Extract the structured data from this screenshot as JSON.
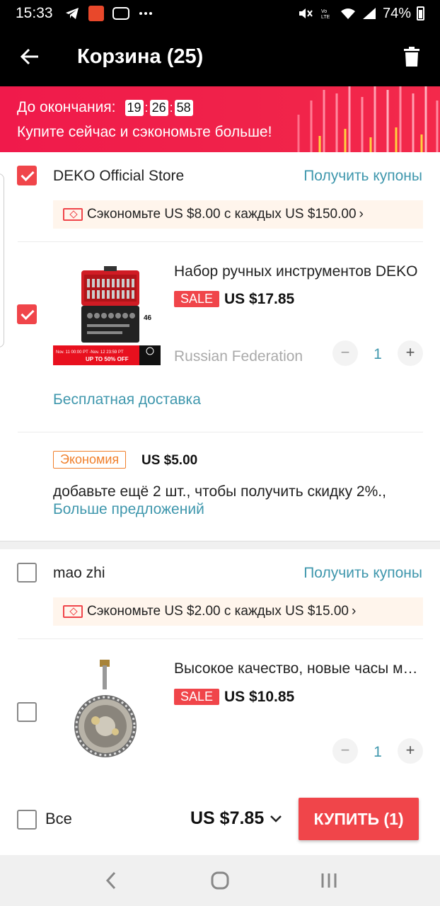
{
  "status_bar": {
    "time": "15:33",
    "battery": "74%",
    "icons": [
      "telegram-icon",
      "aliexpress-icon",
      "messenger-icon",
      "more-dots-icon",
      "mute-icon",
      "volte-icon",
      "wifi-icon",
      "signal-icon",
      "battery-icon"
    ]
  },
  "header": {
    "title": "Корзина (25)",
    "back_icon": "arrow-left-icon",
    "delete_icon": "trash-icon"
  },
  "banner": {
    "countdown_label": "До окончания:",
    "hours": "19",
    "minutes": "26",
    "seconds": "58",
    "slogan": "Купите сейчас и сэкономьте больше!"
  },
  "stores": [
    {
      "name": "DEKO Official Store",
      "checked": true,
      "coupons_link": "Получить купоны",
      "savings": "Сэкономьте US $8.00 с каждых US $150.00",
      "product": {
        "title": "Набор ручных инструментов DEKO",
        "sale_label": "SALE",
        "price": "US $17.85",
        "ship_from": "Russian Federation",
        "quantity": "1",
        "checked": true,
        "image_banner_text": "Nov. 11 00:00 PT -Nov. 12 23:59 PT",
        "image_banner_discount": "UP TO 50% OFF"
      },
      "free_shipping": "Бесплатная доставка",
      "economy_label": "Экономия",
      "economy_amount": "US $5.00",
      "promo_text": "добавьте ещё 2 шт., чтобы получить скидку 2%.,",
      "more_offers": "Больше предложений"
    },
    {
      "name": "mao zhi",
      "checked": false,
      "coupons_link": "Получить купоны",
      "savings": "Сэкономьте US $2.00 с каждых US $15.00",
      "product": {
        "title": "Высокое качество, новые часы механизм",
        "sale_label": "SALE",
        "price": "US $10.85",
        "quantity": "1",
        "checked": false
      }
    }
  ],
  "footer": {
    "select_all": "Все",
    "total": "US $7.85",
    "buy_button": "КУПИТЬ (1)"
  },
  "colors": {
    "accent_red": "#f0454a",
    "link_teal": "#3f97ad",
    "banner_red": "#f01a4b",
    "economy_orange": "#f07f2b"
  }
}
